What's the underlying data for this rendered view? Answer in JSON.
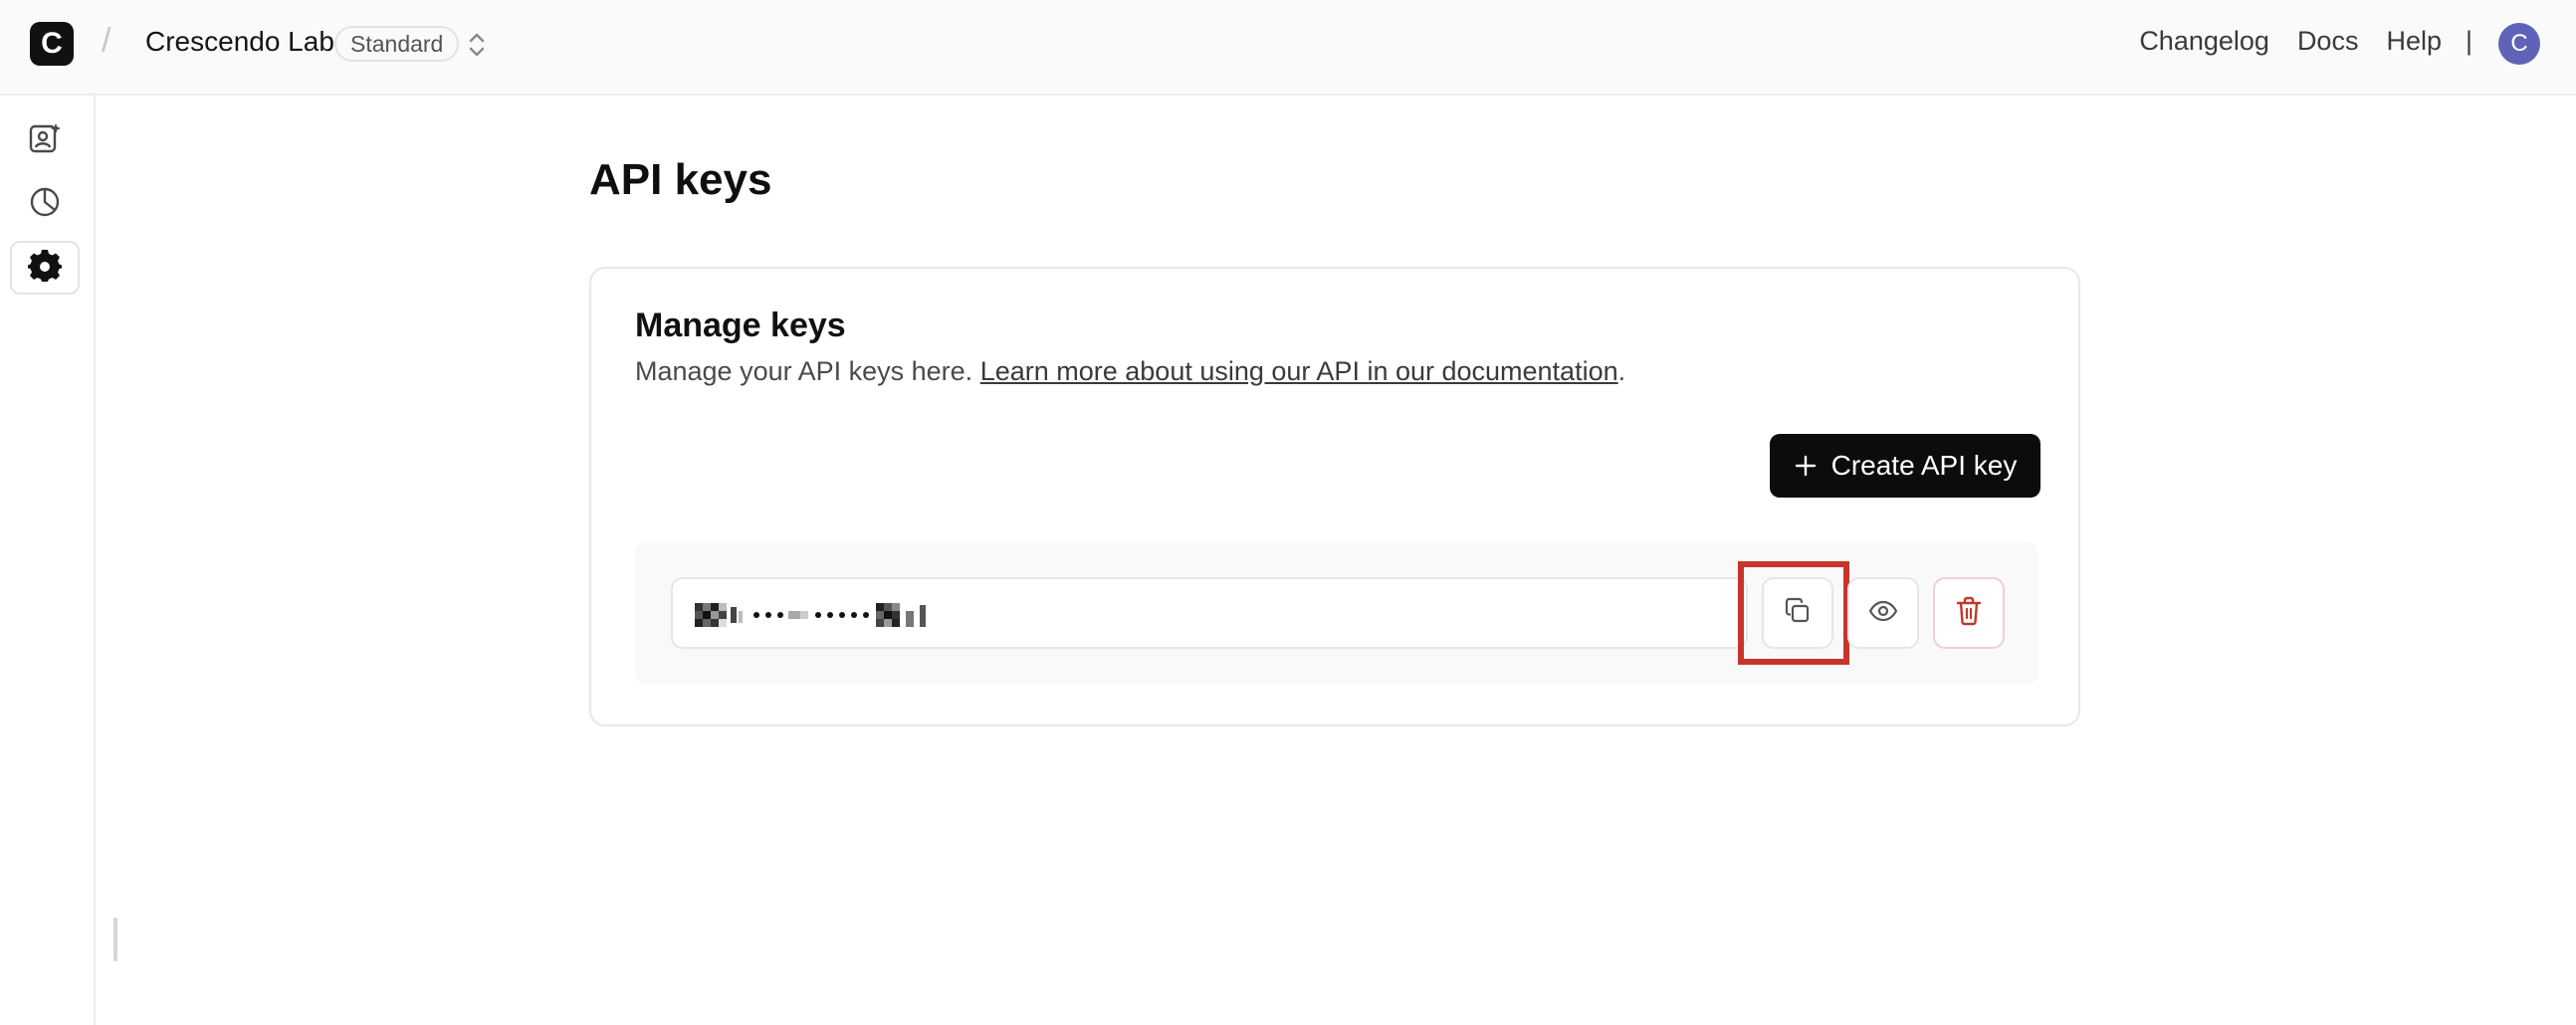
{
  "header": {
    "logo_letter": "C",
    "separator": "/",
    "org_name": "Crescendo Lab",
    "plan_badge": "Standard",
    "nav": [
      "Changelog",
      "Docs",
      "Help"
    ],
    "nav_separator": "|",
    "avatar_letter": "C",
    "avatar_color": "#5f63b8"
  },
  "sidebar": {
    "items": [
      {
        "icon": "user-sparkle-icon",
        "active": false
      },
      {
        "icon": "pie-chart-icon",
        "active": false
      },
      {
        "icon": "gear-icon",
        "active": true
      }
    ]
  },
  "page": {
    "title": "API keys"
  },
  "card": {
    "title": "Manage keys",
    "description_prefix": "Manage your API keys here. ",
    "description_link": "Learn more about using our API in our documentation",
    "description_suffix": ".",
    "create_button_label": "Create API key",
    "create_button_icon": "plus-icon"
  },
  "api_key": {
    "masked_value_obscured": true,
    "actions": [
      "copy-icon",
      "eye-icon",
      "trash-icon"
    ],
    "delete_color": "#c0392b",
    "copy_highlighted": true,
    "highlight_color": "#c9342a"
  }
}
